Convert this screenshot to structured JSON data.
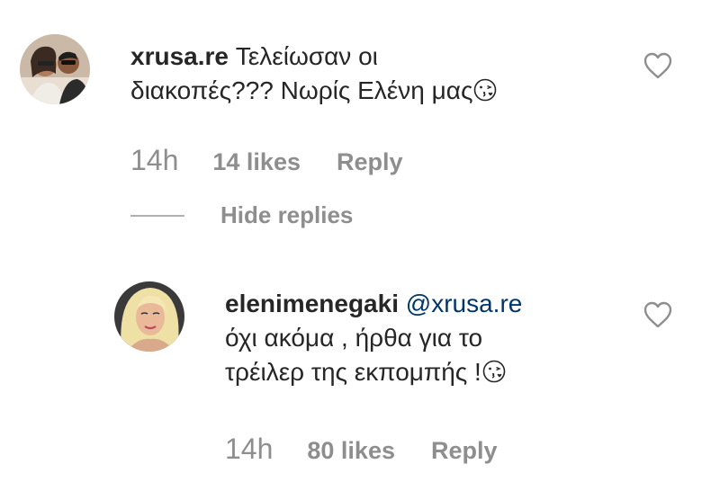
{
  "comment": {
    "username": "xrusa.re",
    "text_line1": "Τελείωσαν οι",
    "text_line2": "διακοπές??? Νωρίς Ελένη μας",
    "emoji": "kissing-face-emoji",
    "time": "14h",
    "likes": "14 likes",
    "reply": "Reply",
    "hide_replies": "Hide replies"
  },
  "reply": {
    "username": "elenimenegaki",
    "mention": "@xrusa.re",
    "text_line1": "όχι ακόμα , ήρθα για το",
    "text_line2": "τρέιλερ της εκπομπής !",
    "emoji": "kissing-face-emoji",
    "time": "14h",
    "likes": "80 likes",
    "reply": "Reply"
  },
  "icons": {
    "like": "heart-outline-icon"
  },
  "colors": {
    "text": "#262626",
    "secondary": "#8e8e8e",
    "mention": "#00376b"
  }
}
